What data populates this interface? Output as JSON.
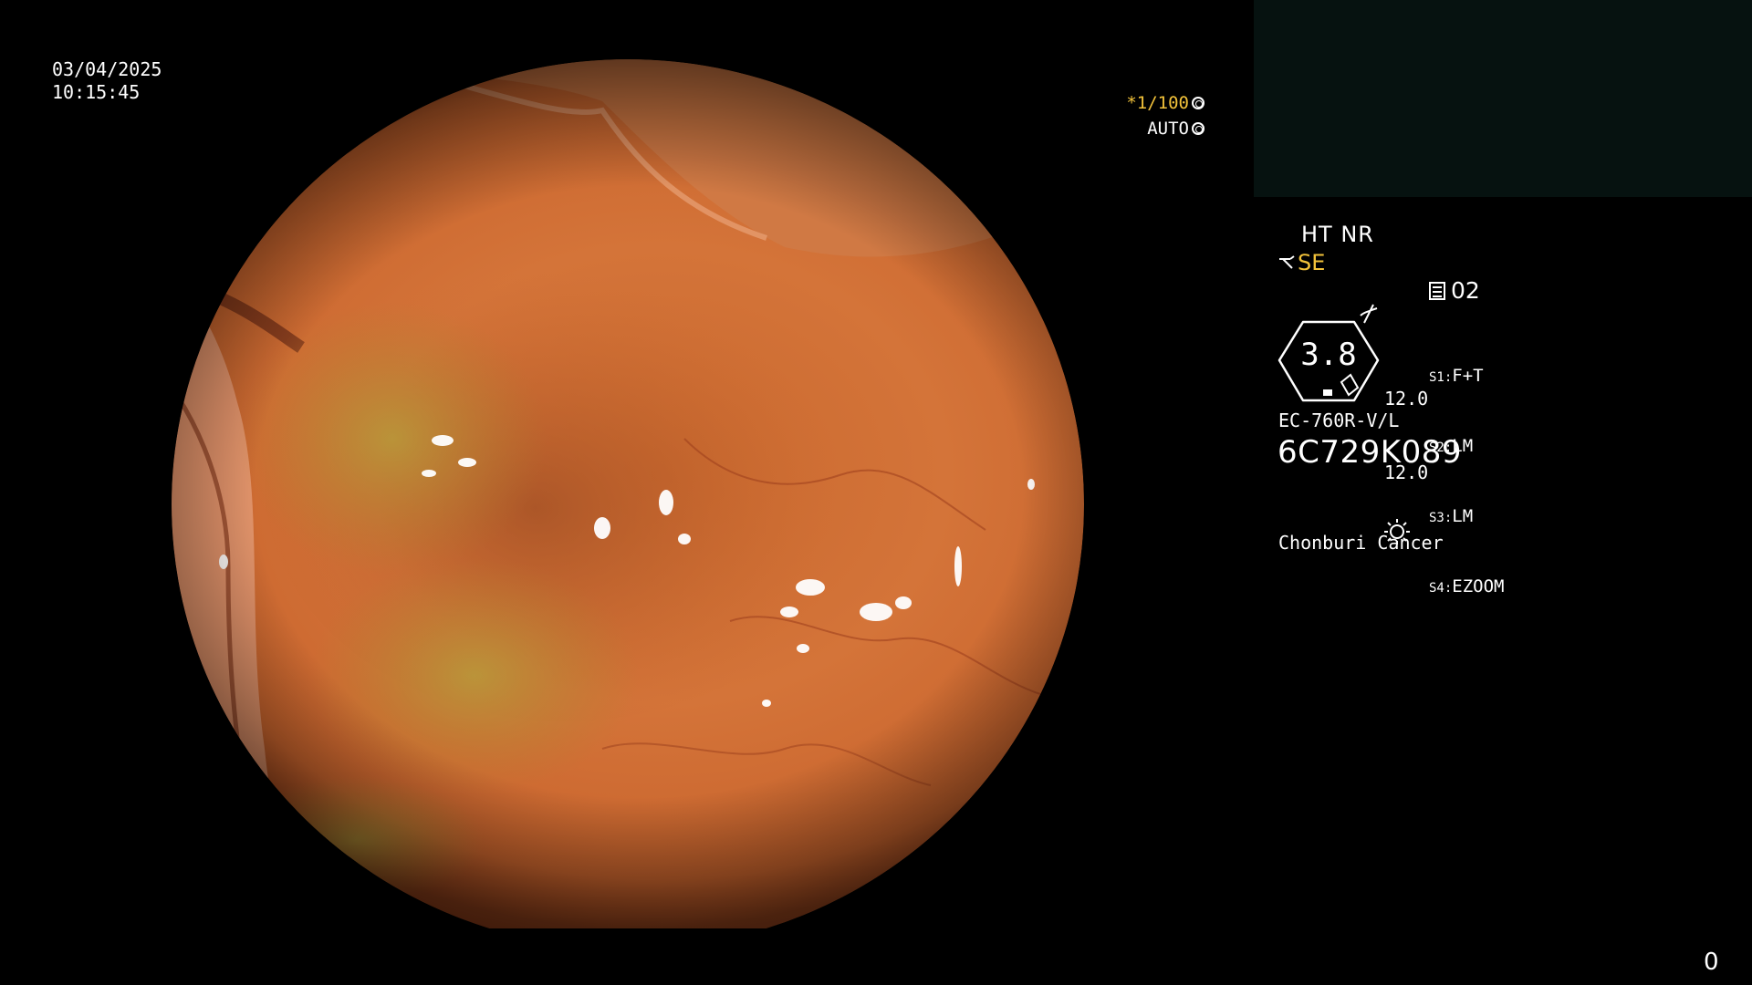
{
  "overlay": {
    "date": "03/04/2025",
    "time": "10:15:45",
    "shutter": "*1/100",
    "iris": "AUTO",
    "mode": "HT NR",
    "enhance": "SE",
    "freeze_icon": "slash-icon",
    "channel": "02",
    "zoom_value": "3.8",
    "value_1": "12.0",
    "value_2": "12.0",
    "scenes": [
      {
        "key": "S1:",
        "value": "F+T"
      },
      {
        "key": "S2:",
        "value": "LM"
      },
      {
        "key": "S3:",
        "value": "LM"
      },
      {
        "key": "S4:",
        "value": "EZOOM"
      }
    ],
    "scope_model": "EC-760R-V/L",
    "serial": "6C729K089",
    "light_icon": "sun-icon",
    "hospital": "Chonburi Cancer",
    "counter": "0"
  },
  "colors": {
    "accent_yellow": "#f2c23a",
    "panel_dark": "#061210",
    "mucosa": "#d9733b"
  }
}
